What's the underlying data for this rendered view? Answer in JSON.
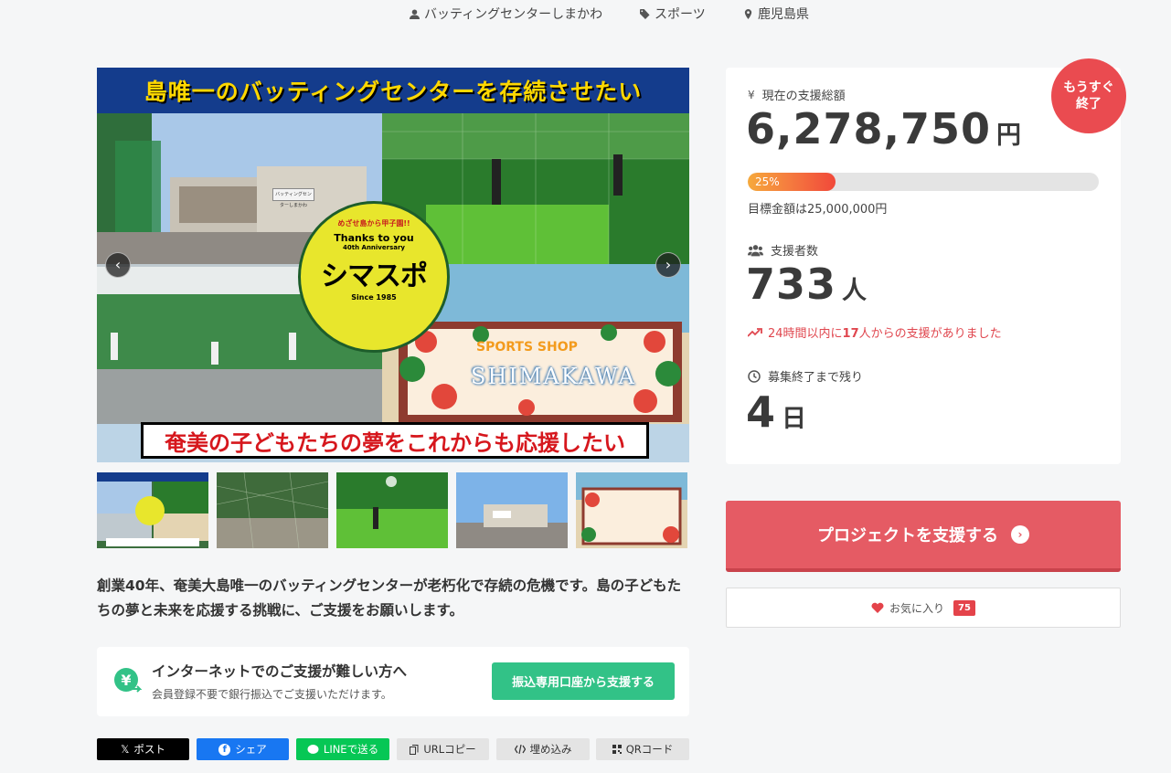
{
  "meta": {
    "organizer": "バッティングセンターしまかわ",
    "category": "スポーツ",
    "location": "鹿児島県"
  },
  "hero": {
    "top_banner": "島唯一のバッティングセンターを存続させたい",
    "bottom_banner": "奄美の子どもたちの夢をこれからも応援したい",
    "logo_line1": "めざせ島から甲子園!!",
    "logo_line2": "Thanks to you",
    "logo_line3": "40th Anniversary",
    "logo_line4": "シマスポ",
    "logo_line5": "Since 1985",
    "sign_board": "バッティングセンターしまかわ",
    "shop_top": "SPORTS SHOP",
    "shop_name": "SHIMAKAWA",
    "prev_glyph": "‹",
    "next_glyph": "›"
  },
  "thumbnails": [
    "thumb-1",
    "thumb-2",
    "thumb-3",
    "thumb-4",
    "thumb-5"
  ],
  "description": "創業40年、奄美大島唯一のバッティングセンターが老朽化で存続の危機です。島の子どもたちの夢と未来を応援する挑戦に、ご支援をお願いします。",
  "bank": {
    "icon_glyph": "¥",
    "title": "インターネットでのご支援が難しい方へ",
    "subtitle": "会員登録不要で銀行振込でご支援いただけます。",
    "button": "振込専用口座から支援する"
  },
  "share": {
    "post": "ポスト",
    "post_icon": "𝕏",
    "facebook": "シェア",
    "facebook_icon": "f",
    "line": "LINEで送る",
    "url_copy": "URLコピー",
    "embed": "埋め込み",
    "qr": "QRコード"
  },
  "stats": {
    "yen_icon": "¥",
    "total_label": "現在の支援総額",
    "total_amount": "6,278,750",
    "total_unit": "円",
    "progress_label": "25%",
    "progress_fraction": 0.25,
    "goal_text": "目標金額は25,000,000円",
    "supporters_label": "支援者数",
    "supporters_count": "733",
    "supporters_unit": "人",
    "trend_prefix": "24時間以内に",
    "trend_count": "17",
    "trend_suffix": "人からの支援がありました",
    "remaining_label": "募集終了まで残り",
    "remaining_count": "4",
    "remaining_unit": "日"
  },
  "badge": {
    "line1": "もうすぐ",
    "line2": "終了"
  },
  "actions": {
    "support": "プロジェクトを支援する",
    "support_arrow": "›",
    "favorite": "お気に入り",
    "favorite_count": "75"
  },
  "colors": {
    "accent_red": "#e55b64",
    "badge_red": "#ea4b50",
    "bank_green": "#32c287",
    "line_green": "#06c755",
    "facebook_blue": "#1877f2"
  }
}
